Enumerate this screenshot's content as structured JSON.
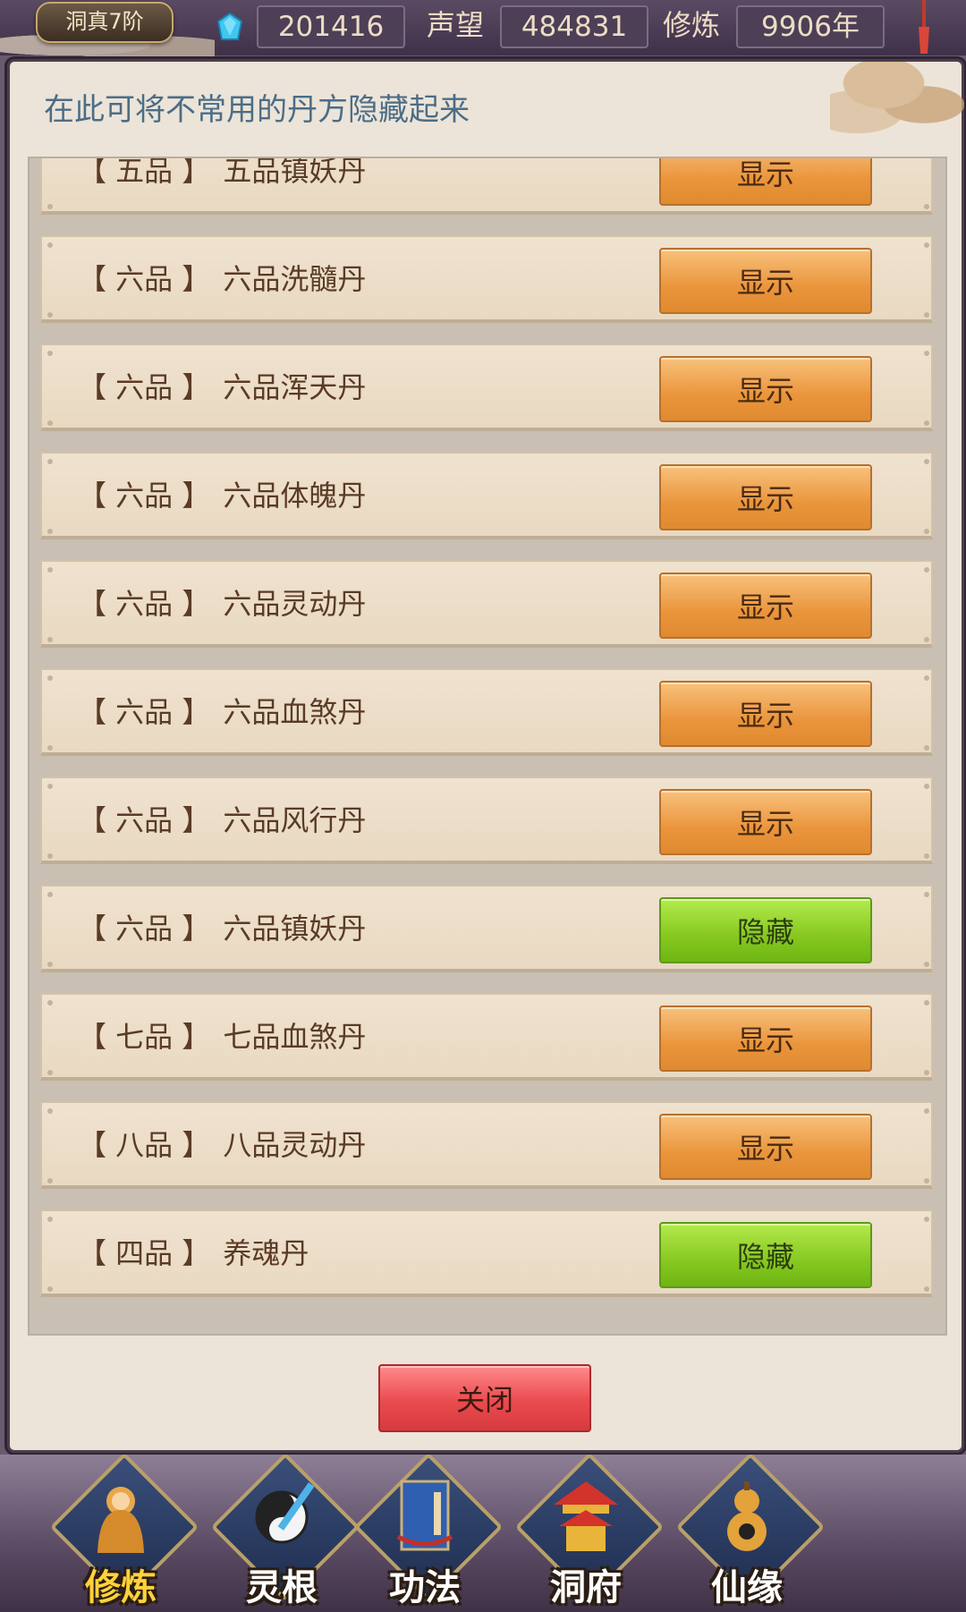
{
  "top_bar": {
    "rank": "洞真7阶",
    "spirit_stones": "201416",
    "reputation_label": "声望",
    "reputation": "484831",
    "cultivation_label": "修炼",
    "cultivation": "9906年"
  },
  "panel": {
    "title": "在此可将不常用的丹方隐藏起来",
    "rows": [
      {
        "grade": "【 五品 】",
        "name": "五品镇妖丹",
        "button": "显示",
        "state": "shown"
      },
      {
        "grade": "【 六品 】",
        "name": "六品洗髓丹",
        "button": "显示",
        "state": "shown"
      },
      {
        "grade": "【 六品 】",
        "name": "六品浑天丹",
        "button": "显示",
        "state": "shown"
      },
      {
        "grade": "【 六品 】",
        "name": "六品体魄丹",
        "button": "显示",
        "state": "shown"
      },
      {
        "grade": "【 六品 】",
        "name": "六品灵动丹",
        "button": "显示",
        "state": "shown"
      },
      {
        "grade": "【 六品 】",
        "name": "六品血煞丹",
        "button": "显示",
        "state": "shown"
      },
      {
        "grade": "【 六品 】",
        "name": "六品风行丹",
        "button": "显示",
        "state": "shown"
      },
      {
        "grade": "【 六品 】",
        "name": "六品镇妖丹",
        "button": "隐藏",
        "state": "hidden"
      },
      {
        "grade": "【 七品 】",
        "name": "七品血煞丹",
        "button": "显示",
        "state": "shown"
      },
      {
        "grade": "【 八品 】",
        "name": "八品灵动丹",
        "button": "显示",
        "state": "shown"
      },
      {
        "grade": "【 四品 】",
        "name": "养魂丹",
        "button": "隐藏",
        "state": "hidden"
      }
    ],
    "close_label": "关闭"
  },
  "bottom_nav": [
    {
      "label": "修炼",
      "icon": "monk-icon",
      "active": true
    },
    {
      "label": "灵根",
      "icon": "yin-yang-sword-icon",
      "active": false
    },
    {
      "label": "功法",
      "icon": "book-icon",
      "active": false
    },
    {
      "label": "洞府",
      "icon": "pavilion-icon",
      "active": false
    },
    {
      "label": "仙缘",
      "icon": "gourd-icon",
      "active": false
    }
  ],
  "colors": {
    "show_button": "#ea953c",
    "hide_button": "#86c81f",
    "close_button": "#ea4b4f",
    "title_text": "#4b6d87",
    "active_nav": "#ffd23a"
  }
}
